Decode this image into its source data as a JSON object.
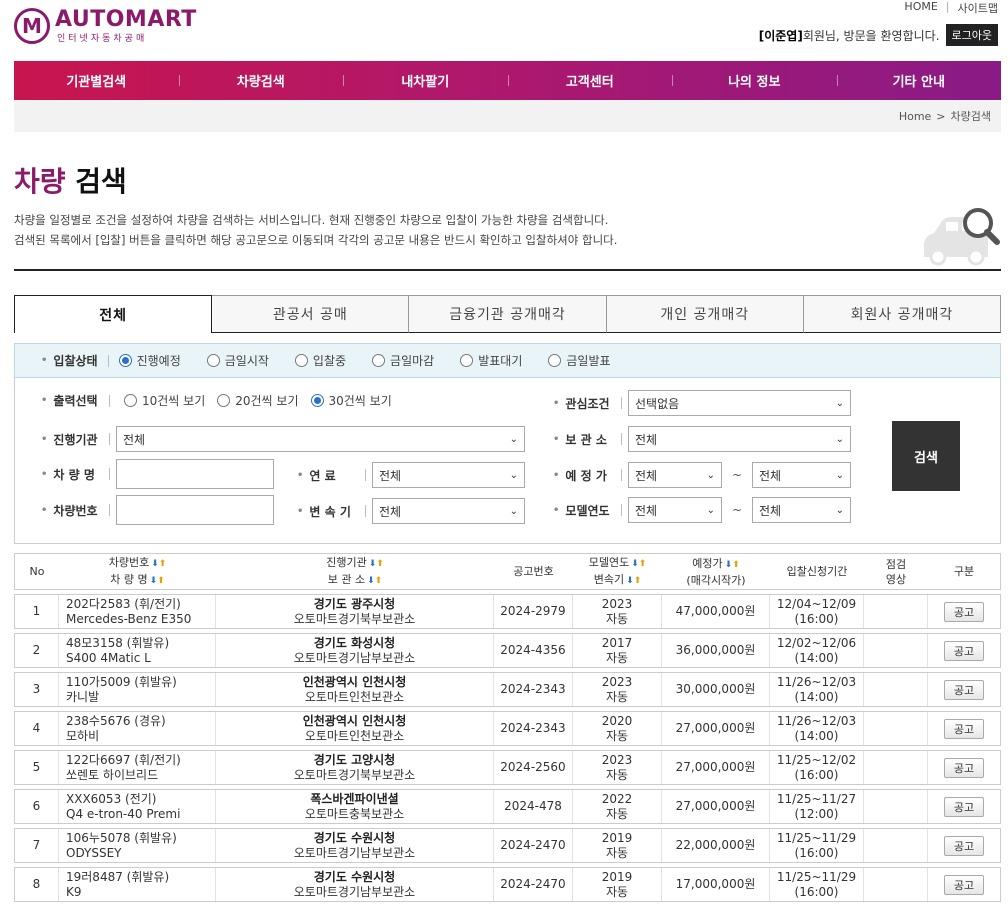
{
  "header": {
    "logo_mark": "M",
    "logo_name": "AUTOMART",
    "logo_sub": "인터넷자동차공매",
    "top_links": [
      "HOME",
      "사이트맵"
    ],
    "user_name": "[이준엽]",
    "welcome_text": "회원님, 방문을 환영합니다.",
    "logout": "로그아웃"
  },
  "nav": [
    "기관별검색",
    "차량검색",
    "내차팔기",
    "고객센터",
    "나의 정보",
    "기타 안내"
  ],
  "breadcrumb": [
    "Home",
    ">",
    "차량검색"
  ],
  "title": {
    "accent": "차량",
    "rest": "검색"
  },
  "description": [
    "차량을 일정별로 조건을 설정하여 차량을 검색하는 서비스입니다. 현재 진행중인 차량으로 입찰이 가능한 차량을 검색합니다.",
    "검색된 목록에서 [입찰] 버튼을 클릭하면 해당 공고문으로 이동되며 각각의 공고문 내용은 반드시 확인하고 입찰하셔야 합니다."
  ],
  "tabs": [
    "전체",
    "관공서 공매",
    "금융기관 공개매각",
    "개인 공개매각",
    "회원사 공개매각"
  ],
  "filters": {
    "status_label": "입찰상태",
    "status_options": [
      "진행예정",
      "금일시작",
      "입찰중",
      "금일마감",
      "발표대기",
      "금일발표"
    ],
    "output_label": "출력선택",
    "output_options": [
      "10건씩 보기",
      "20건씩 보기",
      "30건씩 보기"
    ],
    "interest_label": "관심조건",
    "interest_value": "선택없음",
    "org_label": "진행기관",
    "org_value": "전체",
    "storage_label": "보 관 소",
    "storage_value": "전체",
    "carname_label": "차 량 명",
    "fuel_label": "연 료",
    "fuel_value": "전체",
    "price_label": "예 정 가",
    "price_from": "전체",
    "price_to": "전체",
    "carno_label": "차량번호",
    "trans_label": "변 속 기",
    "trans_value": "전체",
    "year_label": "모델연도",
    "year_from": "전체",
    "year_to": "전체",
    "tilde": "~",
    "search_button": "검색"
  },
  "table": {
    "headers": {
      "no": "No",
      "car1": "차량번호",
      "car2": "차 량 명",
      "org1": "진행기관",
      "org2": "보 관 소",
      "ann": "공고번호",
      "yr1": "모델연도",
      "yr2": "변속기",
      "price1": "예정가",
      "price2": "(매각시작가)",
      "period": "입찰신청기간",
      "chk1": "점검",
      "chk2": "영상",
      "kind": "구분"
    },
    "bid_label": "공고",
    "rows": [
      {
        "no": "1",
        "plate": "202다2583 (휘/전기)",
        "model": "Mercedes-Benz E350",
        "org": "경기도 광주시청",
        "storage": "오토마트경기북부보관소",
        "ann": "2024-2979",
        "year": "2023",
        "trans": "자동",
        "price": "47,000,000원",
        "period": "12/04~12/09",
        "time": "(16:00)"
      },
      {
        "no": "2",
        "plate": "48모3158 (휘발유)",
        "model": "S400 4Matic L",
        "org": "경기도 화성시청",
        "storage": "오토마트경기남부보관소",
        "ann": "2024-4356",
        "year": "2017",
        "trans": "자동",
        "price": "36,000,000원",
        "period": "12/02~12/06",
        "time": "(14:00)"
      },
      {
        "no": "3",
        "plate": "110가5009 (휘발유)",
        "model": "카니발",
        "org": "인천광역시 인천시청",
        "storage": "오토마트인천보관소",
        "ann": "2024-2343",
        "year": "2023",
        "trans": "자동",
        "price": "30,000,000원",
        "period": "11/26~12/03",
        "time": "(14:00)"
      },
      {
        "no": "4",
        "plate": "238수5676 (경유)",
        "model": "모하비",
        "org": "인천광역시 인천시청",
        "storage": "오토마트인천보관소",
        "ann": "2024-2343",
        "year": "2020",
        "trans": "자동",
        "price": "27,000,000원",
        "period": "11/26~12/03",
        "time": "(14:00)"
      },
      {
        "no": "5",
        "plate": "122다6697 (휘/전기)",
        "model": "쏘렌토 하이브리드",
        "org": "경기도 고양시청",
        "storage": "오토마트경기북부보관소",
        "ann": "2024-2560",
        "year": "2023",
        "trans": "자동",
        "price": "27,000,000원",
        "period": "11/25~12/02",
        "time": "(16:00)"
      },
      {
        "no": "6",
        "plate": "XXX6053 (전기)",
        "model": "Q4 e-tron-40 Premi",
        "org": "폭스바겐파이낸셜",
        "storage": "오토마트충북보관소",
        "ann": "2024-478",
        "year": "2022",
        "trans": "자동",
        "price": "27,000,000원",
        "period": "11/25~11/27",
        "time": "(12:00)"
      },
      {
        "no": "7",
        "plate": "106누5078 (휘발유)",
        "model": "ODYSSEY",
        "org": "경기도 수원시청",
        "storage": "오토마트경기남부보관소",
        "ann": "2024-2470",
        "year": "2019",
        "trans": "자동",
        "price": "22,000,000원",
        "period": "11/25~11/29",
        "time": "(16:00)"
      },
      {
        "no": "8",
        "plate": "19러8487 (휘발유)",
        "model": "K9",
        "org": "경기도 수원시청",
        "storage": "오토마트경기남부보관소",
        "ann": "2024-2470",
        "year": "2019",
        "trans": "자동",
        "price": "17,000,000원",
        "period": "11/25~11/29",
        "time": "(16:00)"
      }
    ]
  }
}
